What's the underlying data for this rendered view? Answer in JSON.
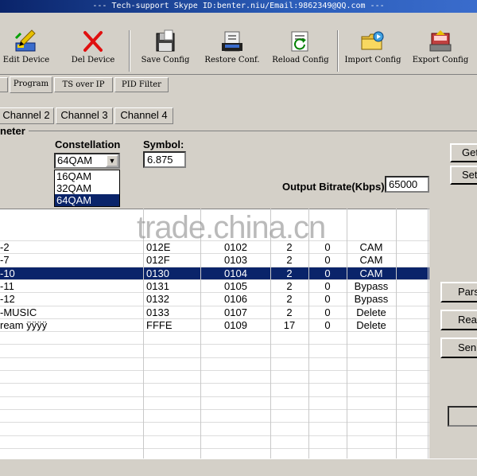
{
  "window": {
    "title": "--- Tech-support Skype ID:benter.niu/Email:9862349@QQ.com ---"
  },
  "toolbar": {
    "buttons": [
      {
        "label": "Edit Device",
        "icon": "edit-device-icon"
      },
      {
        "label": "Del Device",
        "icon": "delete-icon"
      },
      {
        "label": "Save Config",
        "icon": "save-config-icon"
      },
      {
        "label": "Restore Conf.",
        "icon": "restore-config-icon"
      },
      {
        "label": "Reload Config",
        "icon": "reload-config-icon"
      },
      {
        "label": "Import Config",
        "icon": "import-config-icon"
      },
      {
        "label": "Export Config",
        "icon": "export-config-icon"
      }
    ]
  },
  "top_tabs": [
    "Program",
    "TS over IP",
    "PID Filter"
  ],
  "channel_tabs": [
    "Channel 2",
    "Channel 3",
    "Channel 4"
  ],
  "parameter": {
    "group_label": "neter",
    "constellation_label": "Constellation",
    "constellation_value": "64QAM",
    "constellation_options": [
      "16QAM",
      "32QAM",
      "64QAM"
    ],
    "symbol_label": "Symbol:",
    "symbol_value": "6.875",
    "output_bitrate_label": "Output Bitrate(Kbps):",
    "output_bitrate_value": "65000",
    "get_button": "Get",
    "set_button": "Set"
  },
  "watermark": "trade.china.cn",
  "table": {
    "rows": [
      {
        "name": "-2",
        "sid": "012E",
        "pmt": "0102",
        "a": "2",
        "b": "0",
        "mode": "CAM",
        "selected": false
      },
      {
        "name": "-7",
        "sid": "012F",
        "pmt": "0103",
        "a": "2",
        "b": "0",
        "mode": "CAM",
        "selected": false
      },
      {
        "name": "-10",
        "sid": "0130",
        "pmt": "0104",
        "a": "2",
        "b": "0",
        "mode": "CAM",
        "selected": true
      },
      {
        "name": "-11",
        "sid": "0131",
        "pmt": "0105",
        "a": "2",
        "b": "0",
        "mode": "Bypass",
        "selected": false
      },
      {
        "name": "-12",
        "sid": "0132",
        "pmt": "0106",
        "a": "2",
        "b": "0",
        "mode": "Bypass",
        "selected": false
      },
      {
        "name": "-MUSIC",
        "sid": "0133",
        "pmt": "0107",
        "a": "2",
        "b": "0",
        "mode": "Delete",
        "selected": false
      },
      {
        "name": "ream ÿÿÿÿ",
        "sid": "FFFE",
        "pmt": "0109",
        "a": "17",
        "b": "0",
        "mode": "Delete",
        "selected": false
      }
    ]
  },
  "side_buttons": [
    "Pars",
    "Rea",
    "Sen"
  ],
  "colors": {
    "selection": "#0a246a",
    "window_bg": "#d4d0c8",
    "delete_icon": "#e01010"
  }
}
